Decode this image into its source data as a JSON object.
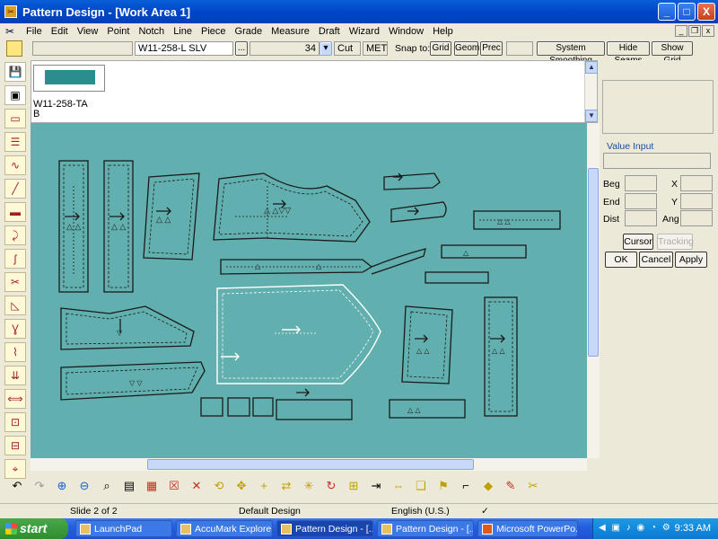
{
  "window": {
    "title": "Pattern Design - [Work Area 1]",
    "min": "_",
    "max": "□",
    "close": "X"
  },
  "menu": [
    "File",
    "Edit",
    "View",
    "Point",
    "Notch",
    "Line",
    "Piece",
    "Grade",
    "Measure",
    "Draft",
    "Wizard",
    "Window",
    "Help"
  ],
  "options_bar": {
    "piece_name": "W11-258-L SLV",
    "browse": "...",
    "size": "34",
    "cut": "Cut",
    "units": "MET",
    "snap_label": "Snap to:",
    "snap_grid": "Grid",
    "snap_geom": "Geom",
    "snap_prec": "Prec",
    "system_smoothing": "System Smoothing",
    "hide_seams": "Hide Seams",
    "show_grid": "Show Grid"
  },
  "thumb": {
    "name": "W11-258-TA",
    "sub": "B"
  },
  "value_input": {
    "title": "Value Input",
    "beg": "Beg",
    "end": "End",
    "dist": "Dist",
    "x": "X",
    "y": "Y",
    "ang": "Ang",
    "cursor": "Cursor",
    "tracking": "Tracking",
    "ok": "OK",
    "cancel": "Cancel",
    "apply": "Apply"
  },
  "status": {
    "slide": "Slide 2 of 2",
    "design": "Default Design",
    "language": "English (U.S.)"
  },
  "taskbar": {
    "start": "start",
    "tasks": [
      "LaunchPad",
      "AccuMark Explorer",
      "Pattern Design - [...",
      "Pattern Design - [...",
      "Microsoft PowerPo..."
    ],
    "clock": "9:33 AM"
  },
  "colors": {
    "canvas": "#62afaf",
    "titlebar": "#0046c8",
    "selected_piece": "#ffffff",
    "piece_outline": "#1a1a1a"
  }
}
